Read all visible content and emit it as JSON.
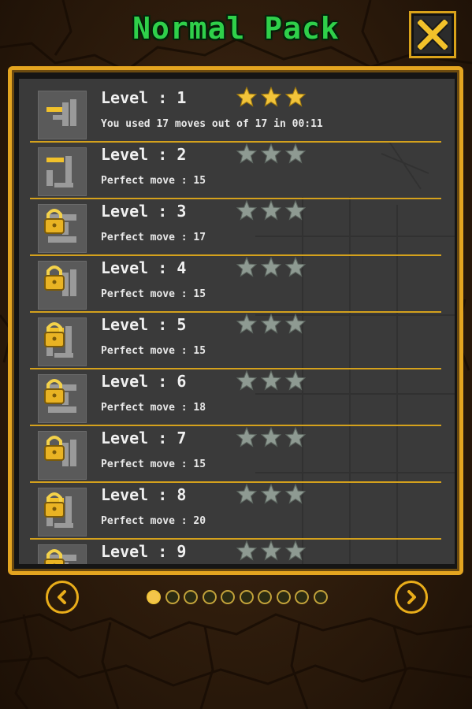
{
  "title": "Normal Pack",
  "accent_color": "#e4a520",
  "title_color": "#2fd04a",
  "levels": [
    {
      "label": "Level : 1",
      "detail": "You used 17 moves out of 17 in 00:11",
      "stars_earned": 3,
      "locked": false
    },
    {
      "label": "Level : 2",
      "detail": "Perfect move : 15",
      "stars_earned": 0,
      "locked": false
    },
    {
      "label": "Level : 3",
      "detail": "Perfect move : 17",
      "stars_earned": 0,
      "locked": true
    },
    {
      "label": "Level : 4",
      "detail": "Perfect move : 15",
      "stars_earned": 0,
      "locked": true
    },
    {
      "label": "Level : 5",
      "detail": "Perfect move : 15",
      "stars_earned": 0,
      "locked": true
    },
    {
      "label": "Level : 6",
      "detail": "Perfect move : 18",
      "stars_earned": 0,
      "locked": true
    },
    {
      "label": "Level : 7",
      "detail": "Perfect move : 15",
      "stars_earned": 0,
      "locked": true
    },
    {
      "label": "Level : 8",
      "detail": "Perfect move : 20",
      "stars_earned": 0,
      "locked": true
    },
    {
      "label": "Level : 9",
      "detail": "",
      "stars_earned": 0,
      "locked": true
    }
  ],
  "pagination": {
    "total_pages": 10,
    "current_page": 1
  },
  "icons": {
    "close": "close-icon",
    "prev": "chevron-left-icon",
    "next": "chevron-right-icon",
    "lock": "lock-icon",
    "star": "star-icon"
  }
}
